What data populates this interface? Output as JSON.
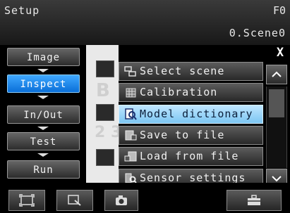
{
  "topbar": {
    "title": "Setup",
    "mode": "F0",
    "scene": "0.Scene0"
  },
  "nav": {
    "items": [
      {
        "label": "Image"
      },
      {
        "label": "Inspect"
      },
      {
        "label": "In/Out"
      },
      {
        "label": "Test"
      },
      {
        "label": "Run"
      }
    ],
    "active": "Inspect"
  },
  "background": {
    "partial_text_1": "B",
    "partial_text_2": "2 3"
  },
  "popup": {
    "close_symbol": "X",
    "items": [
      {
        "label": "Select scene",
        "icon": "select-scene-icon"
      },
      {
        "label": "Calibration",
        "icon": "calibration-icon"
      },
      {
        "label": "Model dictionary",
        "icon": "model-dictionary-icon",
        "selected": true
      },
      {
        "label": "Save to file",
        "icon": "save-file-icon"
      },
      {
        "label": "Load from file",
        "icon": "load-file-icon"
      },
      {
        "label": "Sensor settings",
        "icon": "sensor-settings-icon"
      }
    ],
    "scroll_up": "^",
    "scroll_down": "v"
  },
  "toolbar": {
    "buttons": [
      "frame-icon",
      "zoom-icon",
      "camera-icon",
      "toolbox-icon"
    ]
  },
  "colors": {
    "selected_fill": "#7cc6f2",
    "active_nav": "#0a6fd8"
  }
}
